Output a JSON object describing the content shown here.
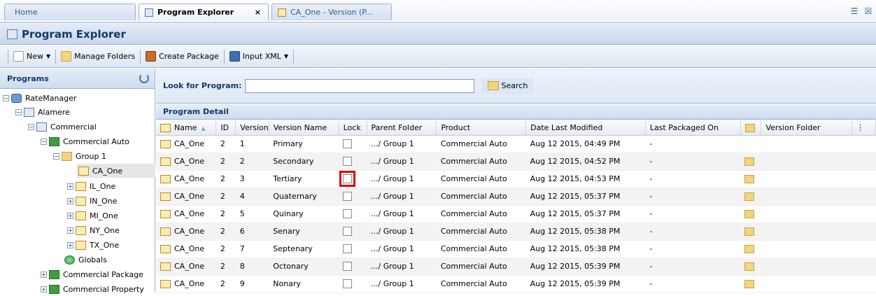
{
  "tabs": [
    {
      "label": "Home"
    },
    {
      "label": "Program Explorer",
      "close": "×"
    },
    {
      "label": "CA_One - Version (P..."
    }
  ],
  "panel_title": "Program Explorer",
  "toolbar": {
    "new_label": "New",
    "manage_folders_label": "Manage Folders",
    "create_package_label": "Create Package",
    "input_xml_label": "Input XML"
  },
  "left_panel": {
    "title": "Programs",
    "tree": [
      {
        "label": "RateManager"
      },
      {
        "label": "Alamere"
      },
      {
        "label": "Commercial"
      },
      {
        "label": "Commercial Auto"
      },
      {
        "label": "Group 1"
      },
      {
        "label": "CA_One"
      },
      {
        "label": "IL_One"
      },
      {
        "label": "IN_One"
      },
      {
        "label": "MI_One"
      },
      {
        "label": "NY_One"
      },
      {
        "label": "TX_One"
      },
      {
        "label": "Globals"
      },
      {
        "label": "Commercial Package"
      },
      {
        "label": "Commercial Property"
      }
    ]
  },
  "search": {
    "label": "Look for Program:",
    "value": "",
    "button": "Search"
  },
  "detail_title": "Program Detail",
  "columns": [
    "Name",
    "ID",
    "Version",
    "Version Name",
    "Lock",
    "Parent Folder",
    "Product",
    "Date Last Modified",
    "Last Packaged On",
    "",
    "Version Folder"
  ],
  "rows": [
    {
      "name": "CA_One",
      "id": "2",
      "version": "1",
      "version_name": "Primary",
      "parent": ".../ Group 1",
      "product": "Commercial Auto",
      "modified": "Aug 12 2015, 04:49 PM",
      "packaged": "-",
      "folder_icon": false
    },
    {
      "name": "CA_One",
      "id": "2",
      "version": "2",
      "version_name": "Secondary",
      "parent": ".../ Group 1",
      "product": "Commercial Auto",
      "modified": "Aug 12 2015, 04:52 PM",
      "packaged": "-",
      "folder_icon": true
    },
    {
      "name": "CA_One",
      "id": "2",
      "version": "3",
      "version_name": "Tertiary",
      "parent": ".../ Group 1",
      "product": "Commercial Auto",
      "modified": "Aug 12 2015, 04:53 PM",
      "packaged": "-",
      "folder_icon": true
    },
    {
      "name": "CA_One",
      "id": "2",
      "version": "4",
      "version_name": "Quaternary",
      "parent": ".../ Group 1",
      "product": "Commercial Auto",
      "modified": "Aug 12 2015, 05:37 PM",
      "packaged": "-",
      "folder_icon": true
    },
    {
      "name": "CA_One",
      "id": "2",
      "version": "5",
      "version_name": "Quinary",
      "parent": ".../ Group 1",
      "product": "Commercial Auto",
      "modified": "Aug 12 2015, 05:37 PM",
      "packaged": "-",
      "folder_icon": true
    },
    {
      "name": "CA_One",
      "id": "2",
      "version": "6",
      "version_name": "Senary",
      "parent": ".../ Group 1",
      "product": "Commercial Auto",
      "modified": "Aug 12 2015, 05:38 PM",
      "packaged": "-",
      "folder_icon": true
    },
    {
      "name": "CA_One",
      "id": "2",
      "version": "7",
      "version_name": "Septenary",
      "parent": ".../ Group 1",
      "product": "Commercial Auto",
      "modified": "Aug 12 2015, 05:38 PM",
      "packaged": "-",
      "folder_icon": true
    },
    {
      "name": "CA_One",
      "id": "2",
      "version": "8",
      "version_name": "Octonary",
      "parent": ".../ Group 1",
      "product": "Commercial Auto",
      "modified": "Aug 12 2015, 05:39 PM",
      "packaged": "-",
      "folder_icon": true
    },
    {
      "name": "CA_One",
      "id": "2",
      "version": "9",
      "version_name": "Nonary",
      "parent": ".../ Group 1",
      "product": "Commercial Auto",
      "modified": "Aug 12 2015, 05:39 PM",
      "packaged": "-",
      "folder_icon": true
    }
  ],
  "highlighted_lock_row": 3,
  "accent_color": "#15386b",
  "highlight_color": "#e00000"
}
